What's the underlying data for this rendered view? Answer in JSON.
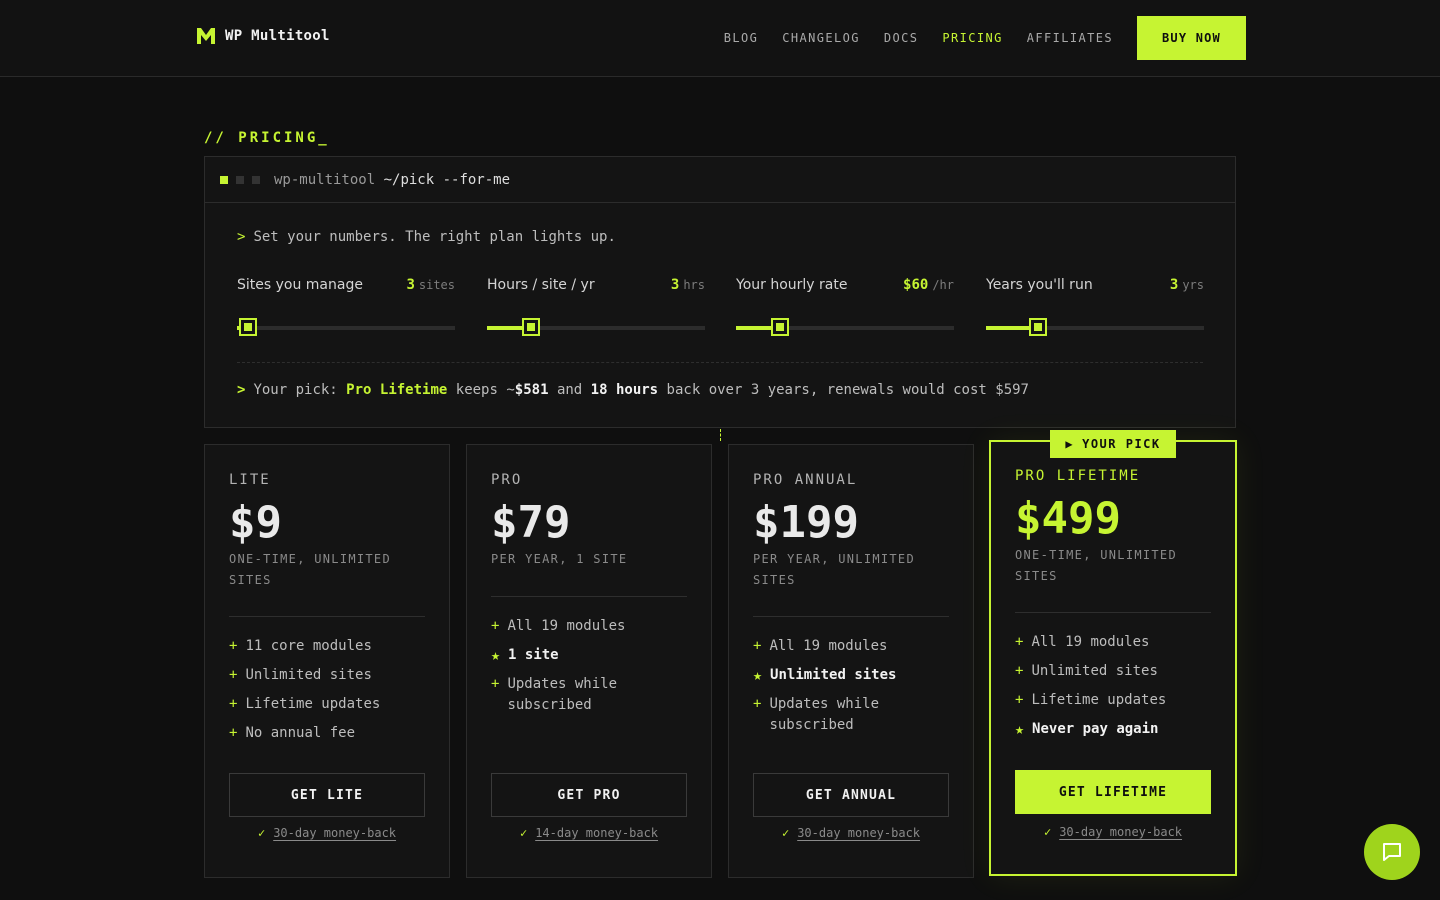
{
  "header": {
    "brand": "WP Multitool",
    "nav": [
      {
        "label": "BLOG",
        "active": false
      },
      {
        "label": "CHANGELOG",
        "active": false
      },
      {
        "label": "DOCS",
        "active": false
      },
      {
        "label": "PRICING",
        "active": true
      },
      {
        "label": "AFFILIATES",
        "active": false
      }
    ],
    "buy_label": "BUY NOW"
  },
  "section_label": "// PRICING_",
  "terminal": {
    "path": "wp-multitool",
    "command": "~/pick --for-me",
    "prompt_symbol": ">",
    "intro": "Set your numbers. The right plan lights up.",
    "sliders": [
      {
        "label": "Sites you manage",
        "value": "3",
        "unit": "sites",
        "fraction": 0.05
      },
      {
        "label": "Hours / site / yr",
        "value": "3",
        "unit": "hrs",
        "fraction": 0.2
      },
      {
        "label": "Your hourly rate",
        "value": "$60",
        "unit": "/hr",
        "fraction": 0.2
      },
      {
        "label": "Years you'll run",
        "value": "3",
        "unit": "yrs",
        "fraction": 0.24
      }
    ],
    "pick": {
      "prefix": "Your pick:",
      "plan": "Pro Lifetime",
      "keeps": "keeps ~",
      "savings": "$581",
      "and": "and",
      "hours": "18 hours",
      "suffix": "back over 3 years, renewals would cost $597"
    }
  },
  "plans": [
    {
      "tier": "LITE",
      "price": "$9",
      "terms": "ONE-TIME, UNLIMITED SITES",
      "features": [
        {
          "text": "11 core modules",
          "star": false
        },
        {
          "text": "Unlimited sites",
          "star": false
        },
        {
          "text": "Lifetime updates",
          "star": false
        },
        {
          "text": "No annual fee",
          "star": false
        }
      ],
      "cta": "GET LITE",
      "guarantee": "30-day money-back"
    },
    {
      "tier": "PRO",
      "price": "$79",
      "terms": "PER YEAR, 1 SITE",
      "features": [
        {
          "text": "All 19 modules",
          "star": false
        },
        {
          "text": "1 site",
          "star": true
        },
        {
          "text": "Updates while subscribed",
          "star": false
        }
      ],
      "cta": "GET PRO",
      "guarantee": "14-day money-back"
    },
    {
      "tier": "PRO ANNUAL",
      "price": "$199",
      "terms": "PER YEAR, UNLIMITED SITES",
      "features": [
        {
          "text": "All 19 modules",
          "star": false
        },
        {
          "text": "Unlimited sites",
          "star": true
        },
        {
          "text": "Updates while subscribed",
          "star": false
        }
      ],
      "cta": "GET ANNUAL",
      "guarantee": "30-day money-back"
    },
    {
      "tier": "PRO LIFETIME",
      "price": "$499",
      "terms": "ONE-TIME, UNLIMITED SITES",
      "badge": "YOUR PICK",
      "features": [
        {
          "text": "All 19 modules",
          "star": false
        },
        {
          "text": "Unlimited sites",
          "star": false
        },
        {
          "text": "Lifetime updates",
          "star": false
        },
        {
          "text": "Never pay again",
          "star": true
        }
      ],
      "cta": "GET LIFETIME",
      "guarantee": "30-day money-back"
    }
  ],
  "colors": {
    "accent": "#c6f432",
    "background": "#0f0f0f",
    "card": "#141414"
  },
  "icons": {
    "logo": "m-logo-icon",
    "chat": "chat-bubble-icon",
    "bullet": "plus",
    "star": "star",
    "check": "check"
  }
}
